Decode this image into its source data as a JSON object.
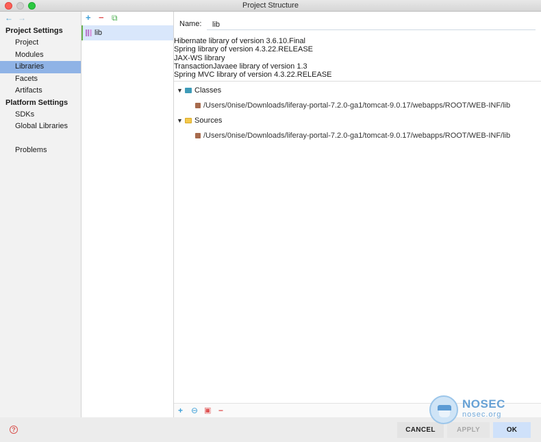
{
  "window": {
    "title": "Project Structure"
  },
  "nav": {
    "back": "←",
    "forward": "→"
  },
  "sidebar": {
    "project_settings_header": "Project Settings",
    "project_items": [
      {
        "label": "Project"
      },
      {
        "label": "Modules"
      },
      {
        "label": "Libraries",
        "selected": true
      },
      {
        "label": "Facets"
      },
      {
        "label": "Artifacts"
      }
    ],
    "platform_settings_header": "Platform Settings",
    "platform_items": [
      {
        "label": "SDKs"
      },
      {
        "label": "Global Libraries"
      }
    ],
    "problems": "Problems"
  },
  "libraries_toolbar": {
    "add": "+",
    "remove": "−",
    "copy": "⧉"
  },
  "libraries": [
    {
      "name": "lib"
    }
  ],
  "detail": {
    "name_label": "Name:",
    "name_value": "lib",
    "descriptions": [
      "Hibernate library of version 3.6.10.Final",
      "Spring library of version 4.3.22.RELEASE",
      "JAX-WS library",
      "TransactionJavaee library of version 1.3",
      "Spring MVC library of version 4.3.22.RELEASE"
    ],
    "tree": {
      "classes": {
        "label": "Classes",
        "path": "/Users/0nise/Downloads/liferay-portal-7.2.0-ga1/tomcat-9.0.17/webapps/ROOT/WEB-INF/lib"
      },
      "sources": {
        "label": "Sources",
        "path": "/Users/0nise/Downloads/liferay-portal-7.2.0-ga1/tomcat-9.0.17/webapps/ROOT/WEB-INF/lib"
      }
    },
    "bottom_toolbar": {
      "add": "+",
      "link": "⊖",
      "folder": "▣",
      "remove": "−"
    }
  },
  "footer": {
    "help": "?",
    "cancel": "CANCEL",
    "apply": "APPLY",
    "ok": "OK"
  },
  "watermark": {
    "brand": "NOSEC",
    "site": "nosec.org"
  },
  "colors": {
    "selection": "#8fb3e6",
    "list_selection": "#d9e7fb",
    "accent_green": "#4caf50",
    "remove_red": "#e05555",
    "ok_button": "#cfe1fa"
  },
  "icons": {
    "library": "library-icon",
    "classes_folder": "classes-folder-icon",
    "sources_folder": "sources-folder-icon",
    "jar": "jar-icon"
  }
}
